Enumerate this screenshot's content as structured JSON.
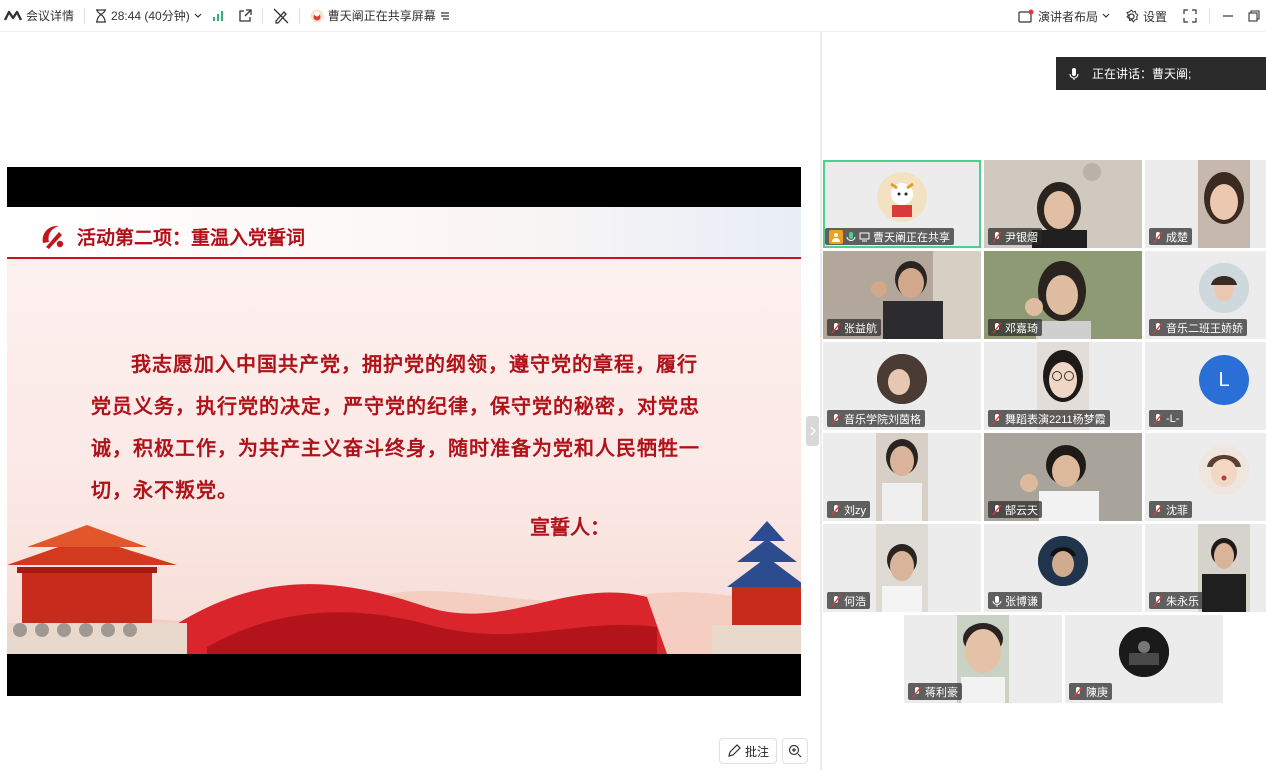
{
  "topbar": {
    "meeting_info": "会议详情",
    "timer": "28:44 (40分钟)",
    "sharing_status": "曹天阐正在共享屏幕",
    "layout_label": "演讲者布局",
    "settings_label": "设置"
  },
  "slide": {
    "title": "活动第二项：重温入党誓词",
    "oath_text": "我志愿加入中国共产党，拥护党的纲领，遵守党的章程，履行党员义务，执行党的决定，严守党的纪律，保守党的秘密，对党忠诚，积极工作，为共产主义奋斗终身，随时准备为党和人民牺牲一切，永不叛党。",
    "signer": "宣誓人："
  },
  "share_controls": {
    "annotate_label": "批注"
  },
  "speaking": {
    "text": "正在讲话：曹天阐;"
  },
  "participants": [
    {
      "name": "曹天阐正在共享",
      "kind": "avatar"
    },
    {
      "name": "尹银熠",
      "kind": "video"
    },
    {
      "name": "成楚",
      "kind": "video"
    },
    {
      "name": "张益航",
      "kind": "video"
    },
    {
      "name": "邓嘉琦",
      "kind": "video"
    },
    {
      "name": "音乐二班王娇娇",
      "kind": "avatar"
    },
    {
      "name": "音乐学院刘茵格",
      "kind": "avatar"
    },
    {
      "name": "舞蹈表演2211杨梦霞",
      "kind": "video"
    },
    {
      "name": "-L-",
      "kind": "letter",
      "letter": "L"
    },
    {
      "name": "刘zy",
      "kind": "video"
    },
    {
      "name": "郜云天",
      "kind": "video"
    },
    {
      "name": "沈菲",
      "kind": "avatar"
    },
    {
      "name": "何浩",
      "kind": "video"
    },
    {
      "name": "张博谦",
      "kind": "avatar"
    },
    {
      "name": "朱永乐",
      "kind": "video"
    },
    {
      "name": "蒋利豪",
      "kind": "video"
    },
    {
      "name": "陳庚",
      "kind": "avatar"
    }
  ],
  "colors": {
    "accent_green": "#4fd08f",
    "slide_red": "#b01219",
    "letter_avatar_blue": "#2a6fd6"
  }
}
